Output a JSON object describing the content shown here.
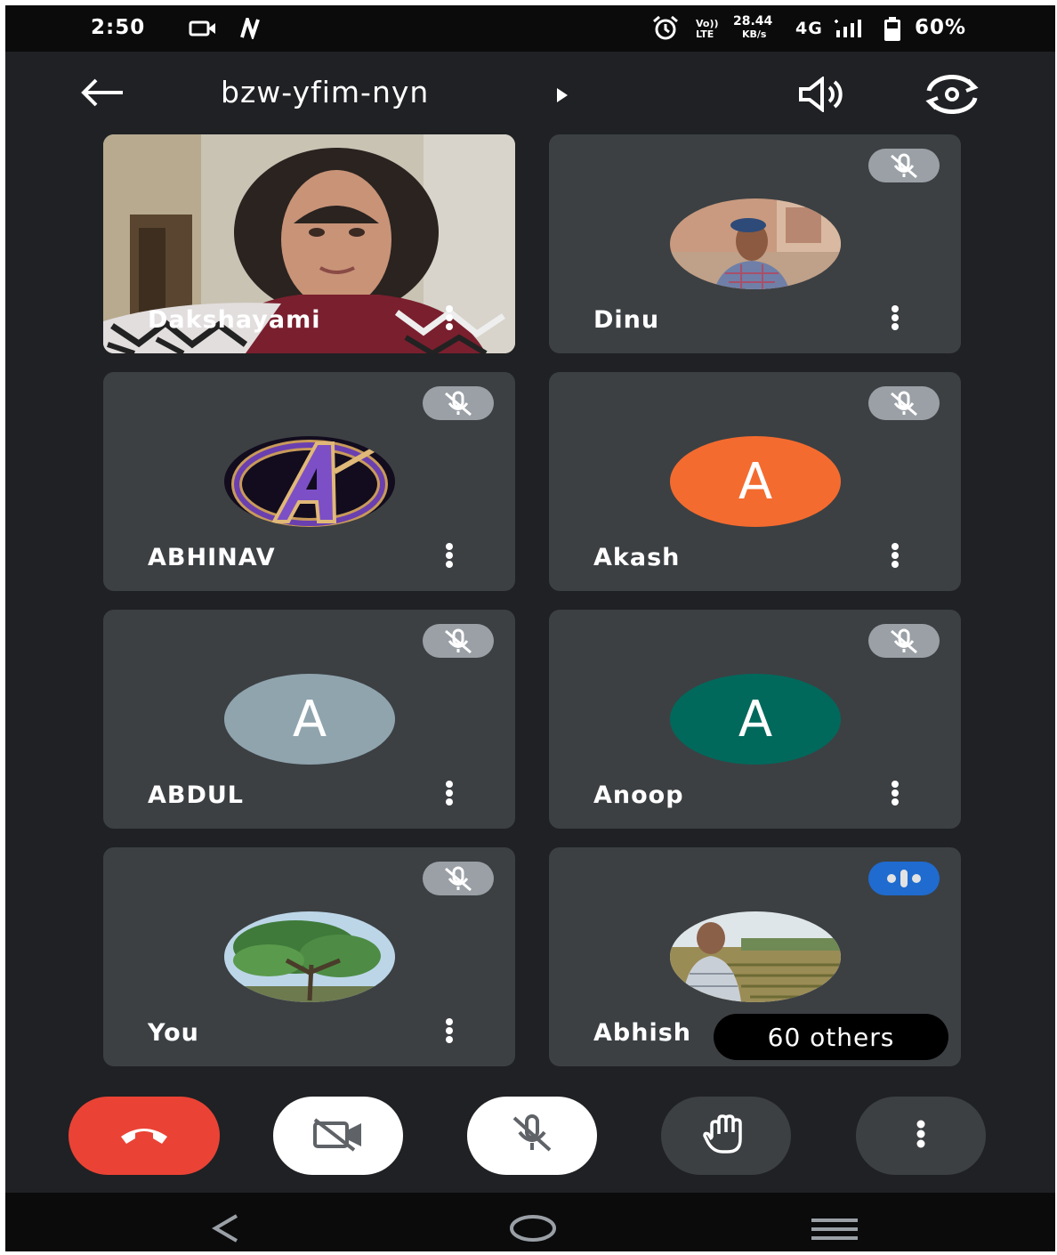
{
  "status_bar": {
    "time": "2:50",
    "volte_top": "Vo))",
    "volte_bottom": "LTE",
    "speed_value": "28.44",
    "speed_unit": "KB/s",
    "network": "4G",
    "battery": "60%"
  },
  "header": {
    "meeting_code": "bzw-yfim-nyn",
    "icons": [
      "back-arrow-icon",
      "play-triangle-icon",
      "speaker-icon",
      "switch-camera-icon"
    ]
  },
  "tiles": [
    {
      "name": "Dakshayami",
      "media": "video",
      "muted": false
    },
    {
      "name": "Dinu",
      "media": "photo",
      "muted": true
    },
    {
      "name": "ABHINAV",
      "media": "avengers-logo",
      "muted": true
    },
    {
      "name": "Akash",
      "media": "letter",
      "letter": "A",
      "color": "#f46b2f",
      "muted": true
    },
    {
      "name": "ABDUL",
      "media": "letter",
      "letter": "A",
      "color": "#90a4ae",
      "muted": true
    },
    {
      "name": "Anoop",
      "media": "letter",
      "letter": "A",
      "color": "#00695c",
      "muted": true
    },
    {
      "name": "You",
      "media": "tree-photo",
      "muted": true
    },
    {
      "name": "Abhish",
      "media": "field-photo",
      "muted": false,
      "speaking": true
    }
  ],
  "others": {
    "label": "60 others"
  },
  "controls": [
    {
      "name": "end-call",
      "icon": "phone-hangup-icon",
      "color": "#ea4335"
    },
    {
      "name": "camera-off",
      "icon": "video-off-icon",
      "color": "#ffffff"
    },
    {
      "name": "mic-off",
      "icon": "mic-off-icon",
      "color": "#ffffff"
    },
    {
      "name": "raise-hand",
      "icon": "hand-icon",
      "color": "#3c4043"
    },
    {
      "name": "more-options",
      "icon": "more-vert-icon",
      "color": "#3c4043"
    }
  ],
  "nav": {
    "icons": [
      "back-nav-icon",
      "home-nav-icon",
      "recents-nav-icon"
    ]
  },
  "colors": {
    "background": "#202124",
    "tile": "#3c4043",
    "muted_badge": "#9aa0a6",
    "speaking_badge": "#1a73e8"
  }
}
